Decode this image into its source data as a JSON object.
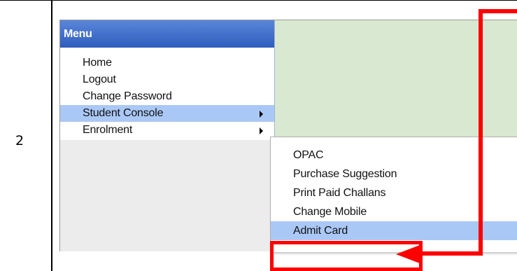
{
  "step_number": "2",
  "menu": {
    "header": "Menu",
    "items": [
      {
        "label": "Home",
        "has_submenu": false,
        "highlighted": false
      },
      {
        "label": "Logout",
        "has_submenu": false,
        "highlighted": false
      },
      {
        "label": "Change Password",
        "has_submenu": false,
        "highlighted": false
      },
      {
        "label": "Student Console",
        "has_submenu": true,
        "highlighted": true
      },
      {
        "label": "Enrolment",
        "has_submenu": true,
        "highlighted": false
      }
    ]
  },
  "submenu": {
    "items": [
      {
        "label": "OPAC",
        "highlighted": false
      },
      {
        "label": "Purchase Suggestion",
        "highlighted": false
      },
      {
        "label": "Print Paid Challans",
        "highlighted": false
      },
      {
        "label": "Change Mobile",
        "highlighted": false
      },
      {
        "label": "Admit Card",
        "highlighted": true
      }
    ]
  },
  "colors": {
    "menu_header": "#3a68c8",
    "highlight": "#aac8f6",
    "content_area": "#d9e9d1",
    "annotation": "#ff0000"
  },
  "icons": [
    "chevron-right-icon",
    "arrow-left-icon"
  ]
}
